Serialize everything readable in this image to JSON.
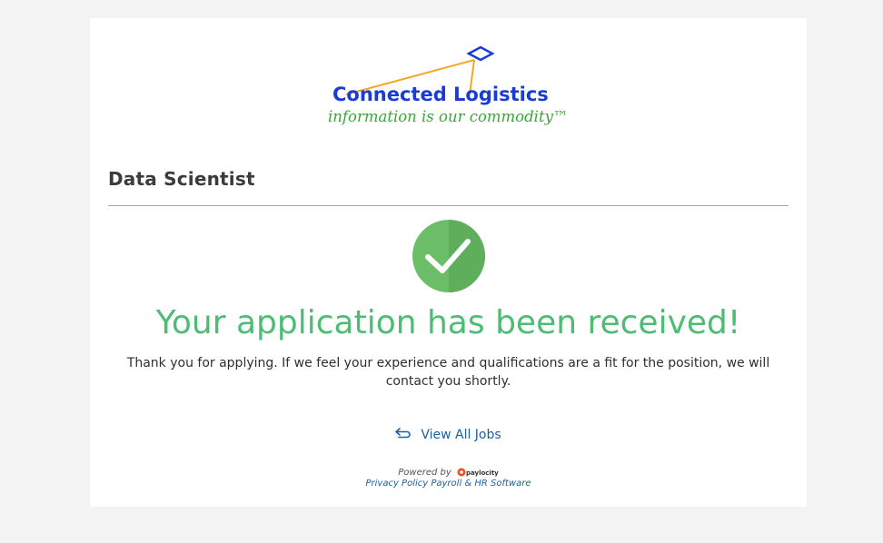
{
  "logo": {
    "company_name": "Connected Logistics",
    "tagline": "information is our commodity™"
  },
  "job": {
    "title": "Data Scientist"
  },
  "confirmation": {
    "icon": "checkmark-circle-icon",
    "headline": "Your application has been received!",
    "message": "Thank you for applying. If we feel your experience and qualifications are a fit for the position, we will contact you shortly."
  },
  "actions": {
    "view_all_jobs_icon": "return-arrow-icon",
    "view_all_jobs_label": "View All Jobs"
  },
  "footer": {
    "powered_by": "Powered by",
    "paylocity_brand": "paylocity",
    "privacy_policy": "Privacy Policy",
    "payroll_link": "Payroll & HR Software"
  },
  "colors": {
    "success_green": "#4dbd74",
    "link_blue": "#1d5f9e",
    "logo_blue": "#1a3cd6",
    "logo_green": "#3aa53a",
    "logo_orange": "#f5a623"
  }
}
